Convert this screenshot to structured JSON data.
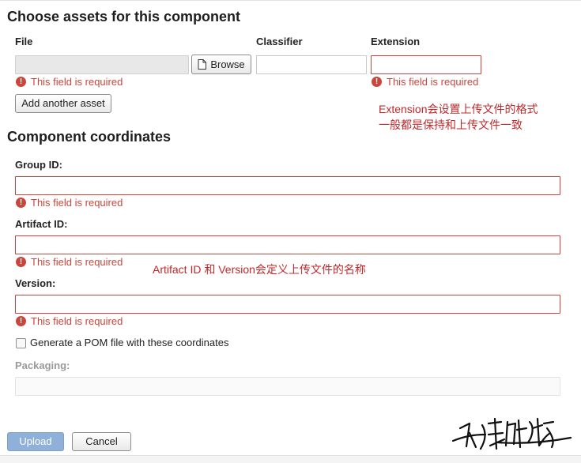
{
  "assets": {
    "title": "Choose assets for this component",
    "file_label": "File",
    "classifier_label": "Classifier",
    "extension_label": "Extension",
    "file_value": "",
    "classifier_value": "",
    "extension_value": "",
    "browse_label": "Browse",
    "file_error": "This field is required",
    "extension_error": "This field is required",
    "add_another_label": "Add another asset"
  },
  "notes": {
    "extension_line1": "Extension会设置上传文件的格式",
    "extension_line2": "一般都是保持和上传文件一致",
    "artifact_note": "Artifact ID 和 Version会定义上传文件的名称"
  },
  "coordinates": {
    "title": "Component coordinates",
    "group_label": "Group ID:",
    "group_value": "",
    "group_error": "This field is required",
    "artifact_label": "Artifact ID:",
    "artifact_value": "",
    "artifact_error": "This field is required",
    "version_label": "Version:",
    "version_value": "",
    "version_error": "This field is required",
    "pom_label": "Generate a POM file with these coordinates",
    "pom_checked": false,
    "packaging_label": "Packaging:",
    "packaging_value": ""
  },
  "footer": {
    "upload_label": "Upload",
    "cancel_label": "Cancel"
  },
  "icons": {
    "error": "error-circle-icon",
    "file": "file-icon",
    "signature": "signature-watermark"
  },
  "colors": {
    "error": "#c9463d",
    "note": "#c2282a",
    "primary_button": "#8fb0d8"
  }
}
